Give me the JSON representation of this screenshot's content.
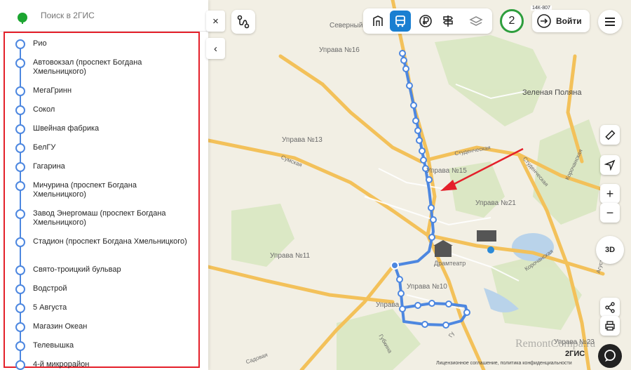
{
  "search": {
    "placeholder": "Поиск в 2ГИС"
  },
  "stops": [
    "Рио",
    "Автовокзал (проспект Богдана Хмельницкого)",
    "МегаГринн",
    "Сокол",
    "Швейная фабрика",
    "БелГУ",
    "Гагарина",
    "Мичурина (проспект Богдана Хмельницкого)",
    "Завод Энергомаш (проспект Богдана Хмельницкого)",
    "Стадион (проспект Богдана Хмельницкого)",
    "Свято-троицкий бульвар",
    "Водстрой",
    "5 Августа",
    "Магазин Океан",
    "Телевышка",
    "4-й микрорайон"
  ],
  "panel_controls": {
    "close_label": "×",
    "collapse_label": "‹"
  },
  "top_bar": {
    "weather_value": "2",
    "login_label": "Войти",
    "road_sign": "14К-807",
    "active_layer": "transport-layer"
  },
  "map_controls": {
    "zoom_in": "+",
    "zoom_out": "−",
    "mode_3d": "3D"
  },
  "map_labels": {
    "severny": "Северный",
    "uprava16": "Управа №16",
    "zelenaya_polyana": "Зеленая Поляна",
    "uprava13": "Управа №13",
    "uprava15": "Управа №15",
    "uprava21": "Управа №21",
    "uprava11": "Управа №11",
    "uprava10": "Управа №10",
    "uprava_bottom": "Управа",
    "uprava23": "Управа №23",
    "dramteatr": "Драмтеатр",
    "sumskaya": "Сумская",
    "studencheskaya1": "Студенческая",
    "studencheskaya2": "Студенческая",
    "korochanskaya1": "Корочанская",
    "korochanskaya2": "Корочанская",
    "gubkina": "Губкина",
    "sadovaya": "Садовая",
    "agustavskaya": "Агустаская",
    "gu": "Гу"
  },
  "footer": {
    "legal": "Лицензионное соглашение, политика конфиденциальности",
    "brand": "2ГИС",
    "watermark": "RemontCompa.ru"
  },
  "colors": {
    "route": "#4d87e0",
    "highlight_box": "#e4202a",
    "arrow": "#e4202a",
    "road": "#f3c15a",
    "map_bg": "#f2efe4",
    "park": "#d7e6bf",
    "layer_active": "#1a7fd1",
    "weather_ring": "#2e9e3d"
  }
}
